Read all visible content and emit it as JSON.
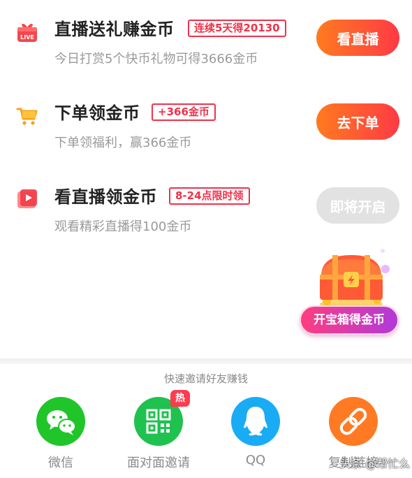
{
  "tasks": [
    {
      "title": "直播送礼赚金币",
      "tag": "连续5天得20130",
      "subtitle": "今日打赏5个快币礼物可得3666金币",
      "button": "看直播",
      "icon": "live-gift-icon"
    },
    {
      "title": "下单领金币",
      "tag": "+366金币",
      "subtitle": "下单领福利，赢366金币",
      "button": "去下单",
      "icon": "shopping-cart-icon"
    },
    {
      "title": "看直播领金币",
      "tag": "8-24点限时领",
      "subtitle": "观看精彩直播得100金币",
      "button": "即将开启",
      "icon": "video-play-icon"
    }
  ],
  "treasure": {
    "label": "开宝箱得金币",
    "icon": "treasure-chest-icon"
  },
  "share": {
    "heading": "快速邀请好友赚钱",
    "hot_badge": "热",
    "items": [
      {
        "label": "微信",
        "icon": "wechat-icon",
        "color": "#1fc529"
      },
      {
        "label": "面对面邀请",
        "icon": "qr-code-icon",
        "color": "#1fc24f"
      },
      {
        "label": "QQ",
        "icon": "qq-icon",
        "color": "#1aabf5"
      },
      {
        "label": "复制链接",
        "icon": "link-icon",
        "color": "#ff7a22"
      }
    ]
  },
  "watermark": "头条 @帮忙么",
  "colors": {
    "accent_red": "#f0314a",
    "button_gradient_start": "#ff7b1f",
    "button_gradient_end": "#ff3a45",
    "disabled": "#e2e2e2"
  }
}
